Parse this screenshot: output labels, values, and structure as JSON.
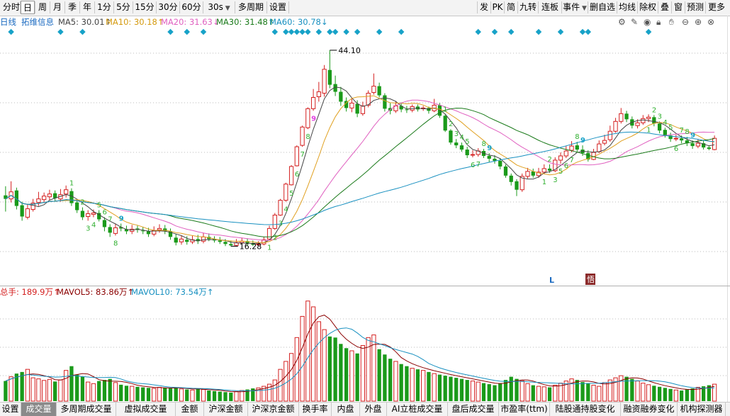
{
  "toolbar": {
    "left": [
      {
        "label": "分时",
        "w": 24
      },
      {
        "label": "日",
        "w": 20,
        "active": true
      },
      {
        "label": "周",
        "w": 20
      },
      {
        "label": "月",
        "w": 20
      },
      {
        "label": "季",
        "w": 20
      },
      {
        "label": "年",
        "w": 20
      },
      {
        "label": "1分",
        "w": 26
      },
      {
        "label": "5分",
        "w": 26
      },
      {
        "label": "15分",
        "w": 32
      },
      {
        "label": "30分",
        "w": 32
      },
      {
        "label": "60分",
        "w": 32
      },
      {
        "label": "30s",
        "w": 44,
        "dropdown": true
      },
      {
        "label": "多周期",
        "w": 44
      },
      {
        "label": "设置",
        "w": 30
      }
    ],
    "right": [
      "发",
      "PK",
      "简",
      "九转",
      "连板",
      "事件",
      "删自选",
      "均线",
      "除权",
      "叠",
      "窗",
      "预测",
      "更多"
    ]
  },
  "ma": {
    "period": "日线",
    "stock": "拓维信息",
    "ma5": "MA5: 30.01↑",
    "ma10": "MA10: 30.18↑",
    "ma20": "MA20: 31.63↓",
    "ma30": "MA30: 31.48↑",
    "ma60": "MA60: 30.78↓"
  },
  "colors": {
    "up": "#d42020",
    "down": "#1a9a1a",
    "ma5": "#444444",
    "ma10": "#e0a020",
    "ma20": "#e060c0",
    "ma30": "#1a7a1a",
    "ma60": "#1890c0",
    "vol_ma5": "#8b0000",
    "vol_ma10": "#1890c0"
  },
  "annotations": {
    "high": "44.10",
    "low": "16.28",
    "mark_L": "L",
    "mark_box": "悟"
  },
  "volume": {
    "total": "总手: 189.9万↑",
    "mavol5": "MAVOL5: 83.86万↑",
    "mavol10": "MAVOL10: 73.54万↑"
  },
  "bottom_tabs": [
    "设置",
    "成交量",
    "多周期成交量",
    "虚拟成交量",
    "金额",
    "沪深金额",
    "沪深京金额",
    "换手率",
    "内盘",
    "外盘",
    "AI立桩成交量",
    "盘后成交量",
    "市盈率(ttm)",
    "陆股通持股变化",
    "融资融券变化",
    "机构探测器"
  ],
  "active_bottom_tab": "成交量",
  "chart_data": {
    "type": "candlestick",
    "price_range": [
      12,
      46
    ],
    "candles": [
      [
        23.5,
        23.0,
        24.8,
        21.2
      ],
      [
        23.0,
        24.0,
        25.5,
        22.5
      ],
      [
        24.2,
        22.0,
        24.6,
        21.5
      ],
      [
        22.1,
        20.5,
        22.6,
        19.9
      ],
      [
        20.4,
        21.6,
        22.2,
        20.1
      ],
      [
        21.5,
        22.4,
        23.0,
        21.2
      ],
      [
        22.5,
        23.0,
        24.0,
        22.0
      ],
      [
        22.9,
        23.4,
        23.9,
        22.5
      ],
      [
        23.3,
        23.7,
        24.3,
        22.8
      ],
      [
        23.8,
        23.1,
        24.2,
        22.6
      ],
      [
        23.0,
        23.6,
        24.4,
        22.6
      ],
      [
        23.7,
        24.3,
        24.9,
        23.2
      ],
      [
        24.1,
        22.4,
        24.5,
        22.0
      ],
      [
        22.5,
        21.4,
        22.9,
        21.0
      ],
      [
        21.3,
        20.4,
        21.8,
        20.0
      ],
      [
        20.5,
        20.9,
        21.4,
        19.9
      ],
      [
        20.8,
        21.0,
        21.5,
        20.4
      ],
      [
        21.0,
        20.1,
        21.4,
        19.8
      ],
      [
        20.0,
        19.0,
        20.4,
        18.4
      ],
      [
        19.0,
        18.2,
        19.4,
        17.6
      ],
      [
        18.1,
        18.9,
        19.5,
        17.8
      ],
      [
        19.0,
        18.8,
        19.5,
        18.4
      ],
      [
        18.7,
        18.4,
        19.2,
        18.0
      ],
      [
        18.4,
        18.7,
        19.3,
        18.0
      ],
      [
        18.8,
        18.6,
        19.2,
        18.2
      ],
      [
        18.5,
        18.4,
        19.0,
        18.0
      ],
      [
        18.4,
        18.0,
        18.9,
        17.6
      ],
      [
        18.0,
        18.5,
        19.1,
        17.7
      ],
      [
        18.6,
        18.8,
        19.4,
        18.2
      ],
      [
        18.8,
        18.4,
        19.3,
        18.0
      ],
      [
        18.4,
        17.6,
        18.8,
        17.2
      ],
      [
        17.5,
        16.8,
        18.0,
        16.4
      ],
      [
        16.9,
        17.3,
        17.8,
        16.5
      ],
      [
        17.2,
        16.9,
        17.7,
        16.5
      ],
      [
        16.9,
        17.2,
        17.8,
        16.6
      ],
      [
        17.3,
        17.0,
        17.9,
        16.6
      ],
      [
        17.0,
        17.6,
        18.2,
        16.7
      ],
      [
        17.6,
        17.3,
        18.1,
        17.0
      ],
      [
        17.3,
        17.1,
        17.7,
        16.8
      ],
      [
        17.1,
        16.9,
        17.6,
        16.6
      ],
      [
        16.9,
        16.6,
        17.3,
        16.3
      ],
      [
        16.6,
        16.4,
        17.1,
        16.28
      ],
      [
        16.4,
        16.8,
        17.3,
        16.3
      ],
      [
        16.8,
        17.0,
        17.5,
        16.5
      ],
      [
        17.0,
        16.7,
        17.4,
        16.4
      ],
      [
        16.7,
        16.5,
        17.1,
        16.3
      ],
      [
        16.5,
        16.6,
        17.0,
        16.3
      ],
      [
        16.6,
        17.2,
        17.6,
        16.4
      ],
      [
        17.3,
        18.8,
        19.2,
        17.2
      ],
      [
        18.8,
        20.7,
        21.0,
        18.6
      ],
      [
        20.7,
        22.8,
        23.0,
        20.6
      ],
      [
        22.8,
        25.1,
        25.3,
        22.6
      ],
      [
        25.0,
        27.6,
        27.8,
        24.9
      ],
      [
        27.7,
        30.4,
        30.6,
        27.6
      ],
      [
        30.6,
        33.2,
        33.4,
        30.4
      ],
      [
        33.1,
        35.8,
        36.0,
        32.9
      ],
      [
        35.8,
        37.4,
        38.6,
        35.5
      ],
      [
        37.5,
        38.2,
        39.6,
        36.8
      ],
      [
        38.0,
        41.4,
        42.0,
        37.5
      ],
      [
        41.3,
        39.2,
        44.1,
        38.7
      ],
      [
        39.3,
        38.2,
        40.5,
        37.6
      ],
      [
        38.2,
        36.8,
        38.9,
        36.2
      ],
      [
        36.9,
        35.9,
        37.4,
        35.4
      ],
      [
        35.9,
        36.6,
        37.3,
        35.3
      ],
      [
        36.5,
        35.1,
        37.0,
        34.6
      ],
      [
        35.1,
        36.2,
        36.8,
        34.8
      ],
      [
        36.3,
        38.0,
        38.4,
        36.0
      ],
      [
        38.1,
        39.0,
        40.8,
        37.8
      ],
      [
        39.0,
        37.7,
        39.5,
        37.4
      ],
      [
        37.7,
        35.8,
        38.0,
        35.4
      ],
      [
        35.9,
        35.5,
        36.6,
        35.0
      ],
      [
        35.5,
        36.2,
        36.9,
        35.2
      ],
      [
        36.2,
        35.7,
        36.7,
        35.3
      ],
      [
        35.7,
        35.6,
        36.2,
        35.2
      ],
      [
        35.6,
        36.1,
        36.4,
        35.3
      ],
      [
        36.1,
        35.7,
        36.4,
        35.4
      ],
      [
        35.8,
        35.9,
        36.2,
        35.5
      ],
      [
        35.9,
        35.5,
        36.1,
        35.1
      ],
      [
        35.5,
        36.3,
        37.2,
        35.3
      ],
      [
        36.3,
        34.8,
        36.6,
        34.5
      ],
      [
        34.8,
        32.7,
        35.0,
        32.5
      ],
      [
        32.7,
        31.0,
        32.9,
        30.7
      ],
      [
        31.0,
        30.6,
        31.5,
        30.2
      ],
      [
        30.6,
        30.0,
        31.0,
        29.7
      ],
      [
        30.0,
        29.2,
        30.4,
        28.8
      ],
      [
        29.2,
        29.3,
        29.9,
        28.9
      ],
      [
        29.3,
        29.8,
        30.2,
        29.0
      ],
      [
        29.8,
        29.1,
        30.1,
        28.8
      ],
      [
        29.1,
        28.7,
        29.5,
        28.2
      ],
      [
        28.7,
        28.4,
        29.2,
        28.0
      ],
      [
        28.4,
        27.6,
        28.8,
        27.2
      ],
      [
        27.6,
        26.3,
        27.9,
        26.0
      ],
      [
        26.3,
        25.4,
        26.6,
        24.9
      ],
      [
        25.5,
        24.3,
        25.8,
        23.4
      ],
      [
        24.3,
        26.2,
        26.6,
        24.0
      ],
      [
        26.2,
        26.9,
        27.4,
        25.9
      ],
      [
        26.9,
        26.3,
        27.3,
        26.0
      ],
      [
        26.3,
        26.8,
        27.4,
        26.0
      ],
      [
        26.8,
        27.3,
        27.9,
        26.5
      ],
      [
        27.3,
        27.0,
        27.9,
        26.7
      ],
      [
        27.0,
        28.5,
        28.9,
        26.8
      ],
      [
        28.5,
        29.1,
        29.6,
        28.0
      ],
      [
        29.1,
        29.8,
        30.5,
        28.8
      ],
      [
        29.9,
        30.5,
        31.2,
        29.6
      ],
      [
        30.6,
        30.0,
        31.1,
        29.6
      ],
      [
        30.0,
        29.5,
        30.6,
        29.1
      ],
      [
        29.5,
        28.6,
        29.9,
        28.3
      ],
      [
        28.6,
        29.6,
        30.1,
        28.5
      ],
      [
        29.7,
        30.8,
        31.3,
        29.5
      ],
      [
        30.9,
        31.3,
        32.1,
        30.6
      ],
      [
        31.4,
        32.6,
        33.4,
        31.1
      ],
      [
        32.6,
        34.0,
        34.5,
        32.4
      ],
      [
        34.0,
        35.1,
        35.9,
        33.7
      ],
      [
        35.1,
        34.3,
        35.5,
        33.9
      ],
      [
        34.3,
        33.4,
        34.7,
        33.0
      ],
      [
        33.4,
        33.8,
        34.3,
        33.0
      ],
      [
        33.8,
        34.4,
        34.9,
        33.5
      ],
      [
        34.4,
        34.6,
        35.0,
        33.9
      ],
      [
        34.6,
        33.7,
        34.9,
        33.3
      ],
      [
        33.7,
        32.7,
        34.0,
        32.3
      ],
      [
        32.8,
        32.0,
        33.1,
        31.7
      ],
      [
        32.0,
        31.5,
        32.4,
        31.1
      ],
      [
        31.5,
        31.6,
        32.1,
        31.2
      ],
      [
        31.6,
        31.3,
        32.0,
        30.9
      ],
      [
        31.3,
        30.9,
        31.8,
        30.5
      ],
      [
        30.9,
        30.5,
        31.3,
        30.1
      ],
      [
        30.5,
        30.9,
        31.5,
        30.2
      ],
      [
        30.9,
        30.3,
        31.3,
        30.0
      ],
      [
        30.3,
        30.1,
        30.6,
        29.9
      ],
      [
        30.0,
        31.6,
        32.0,
        29.9
      ]
    ],
    "volume_range": [
      0,
      190
    ],
    "volumes": [
      38,
      46,
      52,
      55,
      60,
      44,
      42,
      39,
      41,
      37,
      40,
      58,
      66,
      50,
      46,
      36,
      33,
      38,
      40,
      42,
      35,
      31,
      29,
      28,
      27,
      26,
      25,
      24,
      26,
      25,
      24,
      26,
      23,
      22,
      21,
      24,
      22,
      20,
      19,
      18,
      17,
      16,
      18,
      20,
      22,
      24,
      25,
      28,
      32,
      40,
      60,
      75,
      90,
      120,
      160,
      189,
      178,
      150,
      135,
      122,
      120,
      108,
      100,
      95,
      90,
      105,
      120,
      125,
      98,
      88,
      80,
      75,
      70,
      66,
      62,
      60,
      58,
      55,
      52,
      50,
      48,
      46,
      44,
      42,
      40,
      38,
      36,
      34,
      32,
      30,
      34,
      40,
      46,
      42,
      38,
      33,
      30,
      28,
      27,
      26,
      30,
      34,
      38,
      42,
      40,
      36,
      33,
      30,
      28,
      35,
      40,
      44,
      48,
      46,
      42,
      38,
      34,
      31,
      29,
      27,
      25,
      23,
      21,
      20,
      22,
      24,
      26,
      28,
      30,
      32
    ]
  }
}
